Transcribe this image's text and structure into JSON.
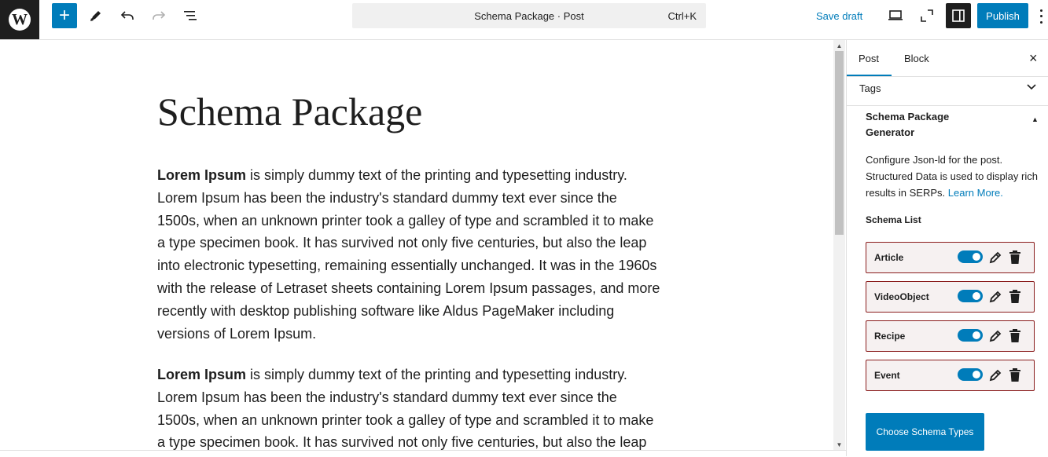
{
  "header": {
    "logo_letter": "W",
    "command": "Schema Package · Post",
    "shortcut": "Ctrl+K",
    "save_draft": "Save draft",
    "publish": "Publish",
    "add": "+"
  },
  "post": {
    "title": "Schema Package",
    "paragraph1_bold": "Lorem Ipsum",
    "paragraph1_rest": " is simply dummy text of the printing and typesetting industry. Lorem Ipsum has been the industry's standard dummy text ever since the 1500s, when an unknown printer took a galley of type and scrambled it to make a type specimen book. It has survived not only five centuries, but also the leap into electronic typesetting, remaining essentially unchanged. It was in the 1960s with the release of Letraset sheets containing Lorem Ipsum passages, and more recently with desktop publishing software like Aldus PageMaker including versions of Lorem Ipsum.",
    "paragraph2_bold": "Lorem Ipsum",
    "paragraph2_rest": " is simply dummy text of the printing and typesetting industry. Lorem Ipsum has been the industry's standard dummy text ever since the 1500s, when an unknown printer took a galley of type and scrambled it to make a type specimen book. It has survived not only five centuries, but also the leap into"
  },
  "sidebar": {
    "tabs": [
      "Post",
      "Block"
    ],
    "close": "×",
    "tags_label": "Tags",
    "generator_title": "Schema Package Generator",
    "generator_desc": "Configure Json-ld for the post. Structured Data is used to display rich results in SERPs.",
    "learn_more": "Learn More.",
    "schema_list_label": "Schema List",
    "schemas": [
      {
        "name": "Article",
        "enabled": true
      },
      {
        "name": "VideoObject",
        "enabled": true
      },
      {
        "name": "Recipe",
        "enabled": true
      },
      {
        "name": "Event",
        "enabled": true
      }
    ],
    "choose_button": "Choose Schema Types"
  },
  "colors": {
    "accent": "#007cba",
    "dark": "#1e1e1e",
    "schema_border": "#8a1c1c"
  }
}
